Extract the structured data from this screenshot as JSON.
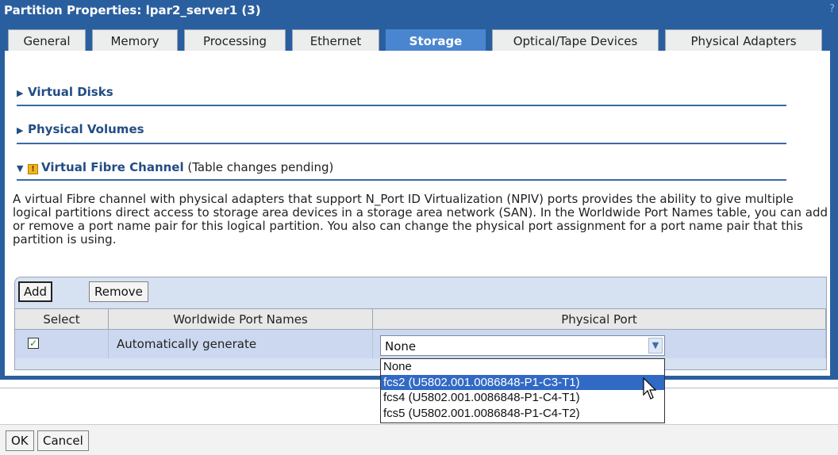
{
  "window": {
    "title": "Partition Properties: lpar2_server1 (3)",
    "help": "?"
  },
  "tabs": [
    {
      "label": "General"
    },
    {
      "label": "Memory"
    },
    {
      "label": "Processing"
    },
    {
      "label": "Ethernet"
    },
    {
      "label": "Storage",
      "active": true
    },
    {
      "label": "Optical/Tape Devices"
    },
    {
      "label": "Physical Adapters"
    }
  ],
  "sections": {
    "virtual_disks": "Virtual Disks",
    "physical_volumes": "Physical Volumes",
    "virtual_fibre": "Virtual Fibre Channel",
    "pending": " (Table changes pending)"
  },
  "description": "A virtual Fibre channel with physical adapters that support N_Port ID Virtualization (NPIV) ports provides the ability to give multiple logical partitions direct access to storage area devices in a storage area network (SAN). In the Worldwide Port Names table, you can add or remove a port name pair for this logical partition. You also can change the physical port assignment for a port name pair that this partition is using.",
  "table": {
    "add_label": "Add",
    "remove_label": "Remove",
    "headers": [
      "Select",
      "Worldwide Port Names",
      "Physical Port"
    ],
    "rows": [
      {
        "selected": true,
        "wwpn": "Automatically generate",
        "port": "None"
      }
    ]
  },
  "dropdown": {
    "options": [
      "None",
      "fcs2 (U5802.001.0086848-P1-C3-T1)",
      "fcs4 (U5802.001.0086848-P1-C4-T1)",
      "fcs5 (U5802.001.0086848-P1-C4-T2)"
    ],
    "highlighted_index": 1
  },
  "footer": {
    "ok_label": "OK",
    "cancel_label": "Cancel"
  },
  "colors": {
    "titlebar": "#2a5f9f",
    "active_tab": "#4a86d0",
    "section_text": "#234d84",
    "row_bg": "#ccd8ef",
    "dropdown_highlight": "#316ac5"
  }
}
